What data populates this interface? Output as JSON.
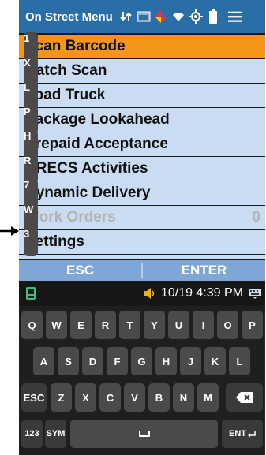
{
  "status_bar": {
    "title": "On Street Menu",
    "icons": [
      "data-transfer-icon",
      "app-window-icon",
      "diamond-icon",
      "wifi-icon",
      "gps-icon",
      "battery-icon",
      "hamburger-menu-icon"
    ]
  },
  "menu": {
    "items": [
      {
        "key": "1",
        "label": "Scan Barcode",
        "count": "",
        "selected": true,
        "disabled": false
      },
      {
        "key": "X",
        "label": "Batch Scan",
        "count": "",
        "selected": false,
        "disabled": false
      },
      {
        "key": "L",
        "label": "Load Truck",
        "count": "",
        "selected": false,
        "disabled": false
      },
      {
        "key": "P",
        "label": "Package Lookahead",
        "count": "",
        "selected": false,
        "disabled": false
      },
      {
        "key": "H",
        "label": "Prepaid Acceptance",
        "count": "",
        "selected": false,
        "disabled": false
      },
      {
        "key": "R",
        "label": "RRECS Activities",
        "count": "",
        "selected": false,
        "disabled": false
      },
      {
        "key": "7",
        "label": "Dynamic Delivery",
        "count": "",
        "selected": false,
        "disabled": false
      },
      {
        "key": "W",
        "label": "Work Orders",
        "count": "0",
        "selected": false,
        "disabled": true
      },
      {
        "key": "3",
        "label": "Settings",
        "count": "",
        "selected": false,
        "disabled": false
      }
    ]
  },
  "actions": {
    "esc": "ESC",
    "enter": "ENTER"
  },
  "system_bar": {
    "time": "10/19 4:39 PM"
  },
  "keyboard": {
    "row1": [
      "Q",
      "W",
      "E",
      "R",
      "T",
      "Y",
      "U",
      "I",
      "O",
      "P"
    ],
    "row2": [
      "A",
      "S",
      "D",
      "F",
      "G",
      "H",
      "J",
      "K",
      "L"
    ],
    "row3_esc": "ESC",
    "row3": [
      "Z",
      "X",
      "C",
      "V",
      "B",
      "N",
      "M"
    ],
    "row4_num": "123",
    "row4_sym": "SYM",
    "row4_enter": "ENT"
  },
  "colors": {
    "header": "#2a6ea8",
    "selected": "#f5951a",
    "item": "#c9dcf2",
    "actionbar": "#7ea6d6"
  }
}
